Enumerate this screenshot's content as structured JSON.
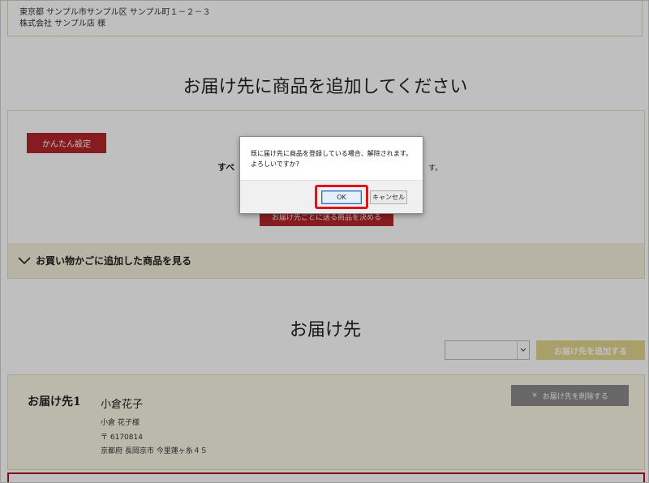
{
  "address": {
    "line1": "東京都 サンプル市サンプル区 サンプル町１－２－３",
    "line2": "株式会社 サンプル店 様"
  },
  "section1": {
    "title": "お届け先に商品を追加してください",
    "easy_setup_label": "かんたん設定",
    "all_items_text_left": "すべ",
    "all_items_text_right": "す。",
    "decide_button_label": "お届け先ごとに送る商品を決める",
    "cart_toggle_label": "お買い物かごに追加した商品を見る"
  },
  "section2": {
    "title": "お届け先",
    "select_value": "",
    "add_button_label": "お届け先を追加する"
  },
  "destination": {
    "label": "お届け先1",
    "name": "小倉花子",
    "name_line": "小倉 花子様",
    "postal": "〒 6170814",
    "address": "京都府 長岡京市 今里蓮ヶ糸４５",
    "delete_label": "お届け先を削除する",
    "delete_symbol": "×"
  },
  "dialog": {
    "message_line1": "既に届け先に商品を登録している場合、解除されます。",
    "message_line2": "よろしいですか?",
    "ok_label": "OK",
    "cancel_label": "キャンセル"
  },
  "colors": {
    "brand_red": "#b3262b",
    "gold": "#e2d48c",
    "highlight": "#e0121c"
  },
  "icons": {
    "cart_toggle": "chevron-down-icon",
    "select_arrow": "dropdown-arrow-icon",
    "delete": "close-icon"
  }
}
